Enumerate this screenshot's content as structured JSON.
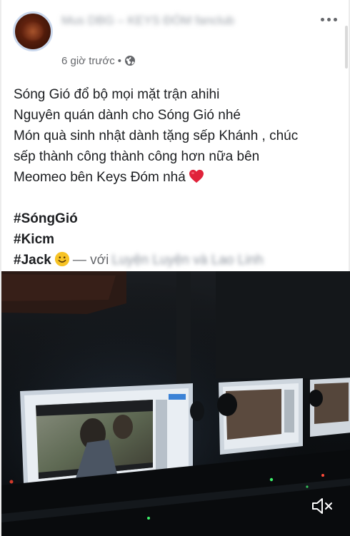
{
  "post": {
    "author_name_blurred": "Mus DBG – KEYS ĐÓM fanclub",
    "timestamp": "6 giờ trước",
    "separator": "•",
    "privacy_icon": "globe-icon",
    "lines": [
      "Sóng Gió đổ bộ mọi mặt trận ahihi",
      "Nguyên quán dành cho Sóng Gió nhé",
      "Món quà sinh nhật dành tặng sếp Khánh , chúc",
      "sếp thành công thành công hơn nữa bên",
      "Meomeo bên Keys Đóm nhá"
    ],
    "hashtags": [
      "#SóngGió",
      "#Kicm",
      "#Jack"
    ],
    "with_label": "— với",
    "tagged_blurred": "Luyện Luyện và Lao Linh"
  },
  "video": {
    "mute_icon": "speaker-muted-icon"
  },
  "colors": {
    "text": "#1c1e21",
    "meta": "#65676b",
    "heart": "#e0223a",
    "video_bg": "#0c0f12"
  }
}
